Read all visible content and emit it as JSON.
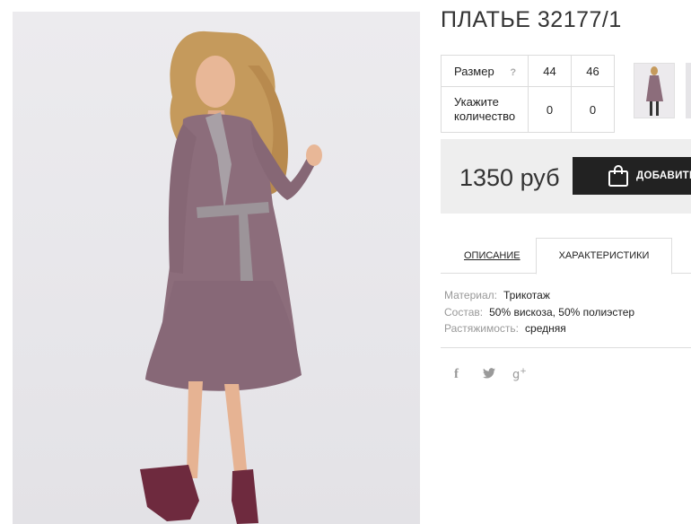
{
  "product": {
    "title": "ПЛАТЬЕ 32177/1",
    "price": "1350 руб",
    "add_button": "ДОБАВИТЬ"
  },
  "size_table": {
    "size_label": "Размер",
    "help_mark": "?",
    "sizes": [
      "44",
      "46"
    ],
    "qty_label_line1": "Укажите",
    "qty_label_line2": "количество",
    "quantities": [
      "0",
      "0"
    ]
  },
  "tabs": {
    "description": "ОПИСАНИЕ",
    "characteristics": "ХАРАКТЕРИСТИКИ",
    "active": "characteristics"
  },
  "specs": [
    {
      "key": "Материал:",
      "value": "Трикотаж"
    },
    {
      "key": "Состав:",
      "value": "50% вискоза, 50% полиэстер"
    },
    {
      "key": "Растяжимость:",
      "value": "средняя"
    }
  ],
  "social": {
    "facebook": "f",
    "twitter": "t",
    "google_plus": "g",
    "google_plus_sup": "+"
  },
  "icons": {
    "bag": "shopping-bag-icon"
  },
  "colors": {
    "dress": "#8a6a78",
    "button": "#222222",
    "price_bg": "#eeeeee"
  }
}
